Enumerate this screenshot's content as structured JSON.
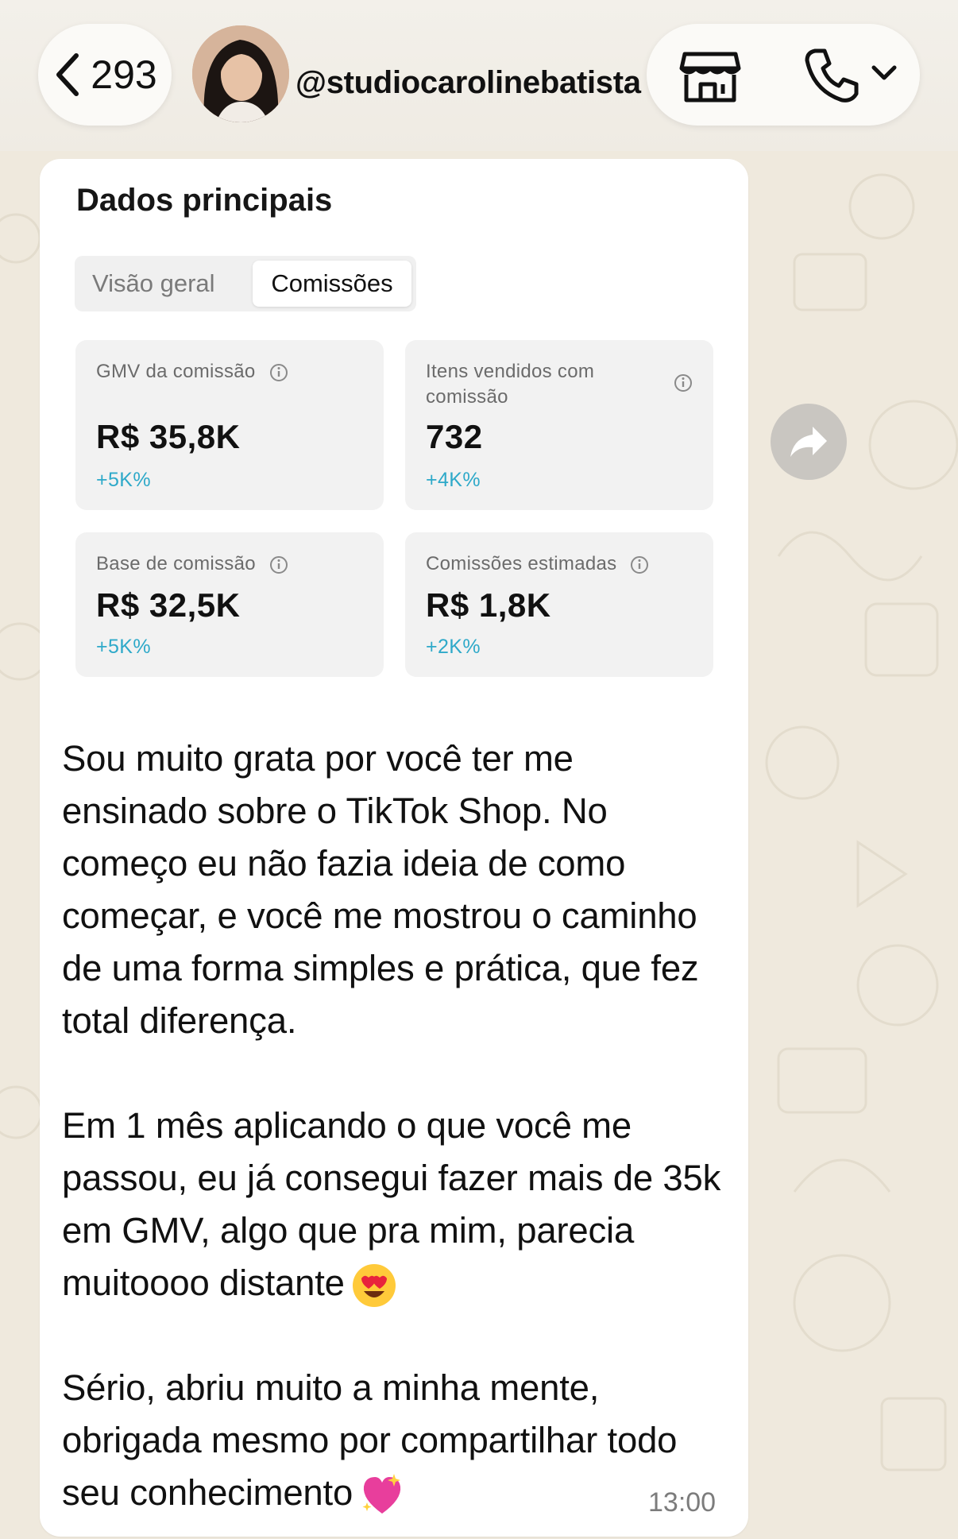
{
  "header": {
    "back_count": "293",
    "username": "@studiocarolinebatista"
  },
  "dashboard": {
    "title": "Dados principais",
    "tabs": [
      {
        "label": "Visão geral",
        "selected": false
      },
      {
        "label": "Comissões",
        "selected": true
      }
    ],
    "cards": [
      {
        "label": "GMV da comissão",
        "value": "R$ 35,8K",
        "change": "+5K%"
      },
      {
        "label": "Itens vendidos com comissão",
        "value": "732",
        "change": "+4K%"
      },
      {
        "label": "Base de comissão",
        "value": "R$ 32,5K",
        "change": "+5K%"
      },
      {
        "label": "Comissões estimadas",
        "value": "R$ 1,8K",
        "change": "+2K%"
      }
    ]
  },
  "message": {
    "paragraph_1": "Sou muito grata por você ter me ensinado sobre o TikTok Shop. No começo eu não fazia ideia de como começar, e você me mostrou o caminho de uma forma simples e prática, que fez total diferença.",
    "paragraph_2": "Em 1 mês aplicando o que você me passou, eu já consegui fazer mais de 35k em GMV, algo que pra mim, parecia muitoooo distante",
    "paragraph_3": "Sério, abriu muito a minha mente, obrigada mesmo por compartilhar todo seu conhecimento",
    "timestamp": "13:00"
  },
  "icons": {
    "back": "chevron-left-icon",
    "shop": "storefront-icon",
    "call": "phone-icon",
    "dropdown": "chevron-down-icon",
    "info": "info-icon",
    "forward": "share-forward-icon",
    "emoji_1": "heart-eyes-emoji",
    "emoji_2": "sparkling-heart-emoji"
  },
  "colors": {
    "change_positive": "#2ea9c9",
    "wallpaper": "#efe9dd"
  }
}
